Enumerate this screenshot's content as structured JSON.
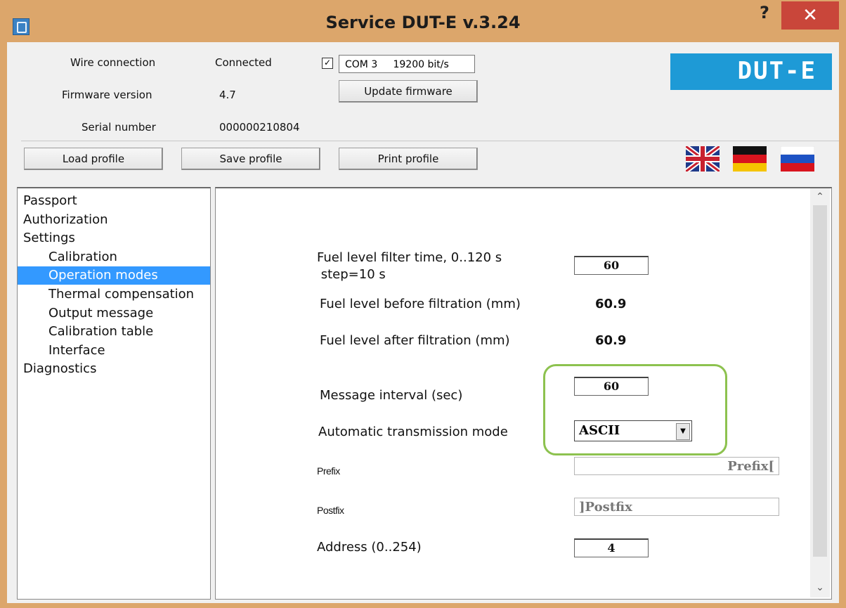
{
  "window": {
    "title": "Service DUT-E  v.3.24",
    "help_glyph": "?",
    "close_glyph": "✕"
  },
  "header": {
    "wire_connection_label": "Wire connection",
    "wire_connection_value": "Connected",
    "firmware_version_label": "Firmware version",
    "firmware_version_value": "4.7",
    "serial_number_label": "Serial number",
    "serial_number_value": "000000210804",
    "com_checkbox_checked": true,
    "com_port": "COM 3     19200 bit/s",
    "update_firmware_label": "Update firmware",
    "logo_text": "DUT-E"
  },
  "toolbar": {
    "load_profile_label": "Load profile",
    "save_profile_label": "Save profile",
    "print_profile_label": "Print profile"
  },
  "languages": [
    "english-flag",
    "german-flag",
    "russian-flag"
  ],
  "sidebar": {
    "items": [
      {
        "label": "Passport",
        "level": 0
      },
      {
        "label": "Authorization",
        "level": 0
      },
      {
        "label": "Settings",
        "level": 0
      },
      {
        "label": "Calibration",
        "level": 1
      },
      {
        "label": "Operation modes",
        "level": 1,
        "selected": true
      },
      {
        "label": "Thermal compensation",
        "level": 1
      },
      {
        "label": "Output message",
        "level": 1
      },
      {
        "label": "Calibration table",
        "level": 1
      },
      {
        "label": "Interface",
        "level": 1
      },
      {
        "label": "Diagnostics",
        "level": 0
      }
    ]
  },
  "panel": {
    "filter_time_label_1": "Fuel level filter time, 0..120 s",
    "filter_time_label_2": " step=10 s",
    "filter_time_value": "60",
    "before_filtration_label": "Fuel level before filtration (mm)",
    "before_filtration_value": "60.9",
    "after_filtration_label": "Fuel level after filtration (mm)",
    "after_filtration_value": "60.9",
    "message_interval_label": "Message interval (sec)",
    "message_interval_value": "60",
    "transmission_mode_label": "Automatic transmission mode",
    "transmission_mode_value": "ASCII",
    "prefix_label": "Prefix",
    "prefix_value": "Prefix[",
    "postfix_label": "Postfix",
    "postfix_value": "]Postfix",
    "address_label": "Address (0..254)",
    "address_value": "4"
  },
  "colors": {
    "title_bar": "#dca66b",
    "close_button": "#c9463a",
    "logo": "#1e9ad6",
    "selection": "#3399ff",
    "highlight": "#8dc24f"
  }
}
